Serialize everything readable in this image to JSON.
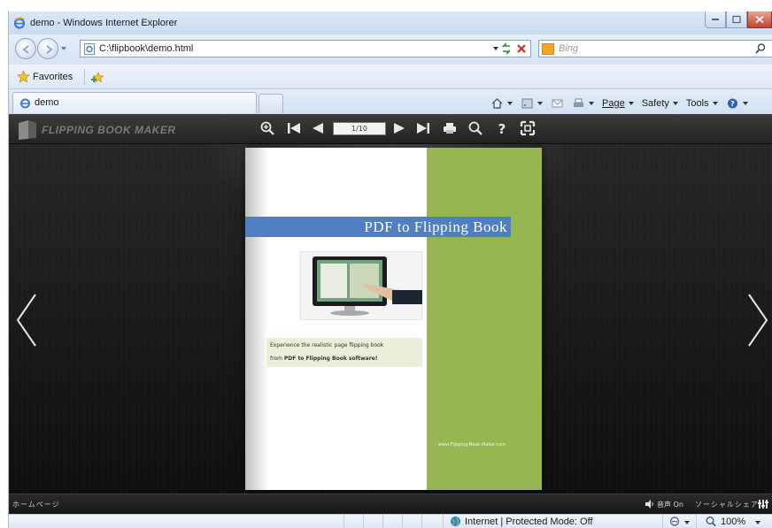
{
  "window": {
    "title": "demo - Windows Internet Explorer"
  },
  "address": {
    "url": "C:\\flipbook\\demo.html"
  },
  "search": {
    "placeholder": "Bing"
  },
  "favorites": {
    "label": "Favorites"
  },
  "tab": {
    "label": "demo"
  },
  "commandbar": {
    "page": "Page",
    "safety": "Safety",
    "tools": "Tools"
  },
  "flipbook": {
    "brand": "FLIPPING BOOK MAKER",
    "page_indicator": "1/10",
    "page": {
      "title": "PDF to Flipping Book",
      "caption_line1": "Experience the realistic page flipping book",
      "caption_line2_prefix": "from ",
      "caption_line2_bold": "PDF to Flipping Book software!",
      "site": "www.Flipping-Book-Maker.com"
    },
    "bottom_left": "ホームページ",
    "sound_label": "音声 On",
    "social_label": "ソーシャルシェア",
    "colors": {
      "green": "#96b651",
      "blue_band": "#4f7fc0"
    }
  },
  "statusbar": {
    "zone": "Internet | Protected Mode: Off",
    "zoom": "100%"
  },
  "icons": [
    "ie-icon",
    "back-icon",
    "forward-icon",
    "refresh-icon",
    "stop-icon",
    "search-icon",
    "favorites-star-icon",
    "add-favorite-icon",
    "home-icon",
    "feeds-icon",
    "mail-icon",
    "print-icon",
    "help-icon",
    "zoom-in-icon",
    "first-page-icon",
    "prev-page-icon",
    "next-page-icon",
    "last-page-icon",
    "search-book-icon",
    "fullscreen-icon",
    "globe-icon",
    "sound-icon",
    "share-icon"
  ]
}
